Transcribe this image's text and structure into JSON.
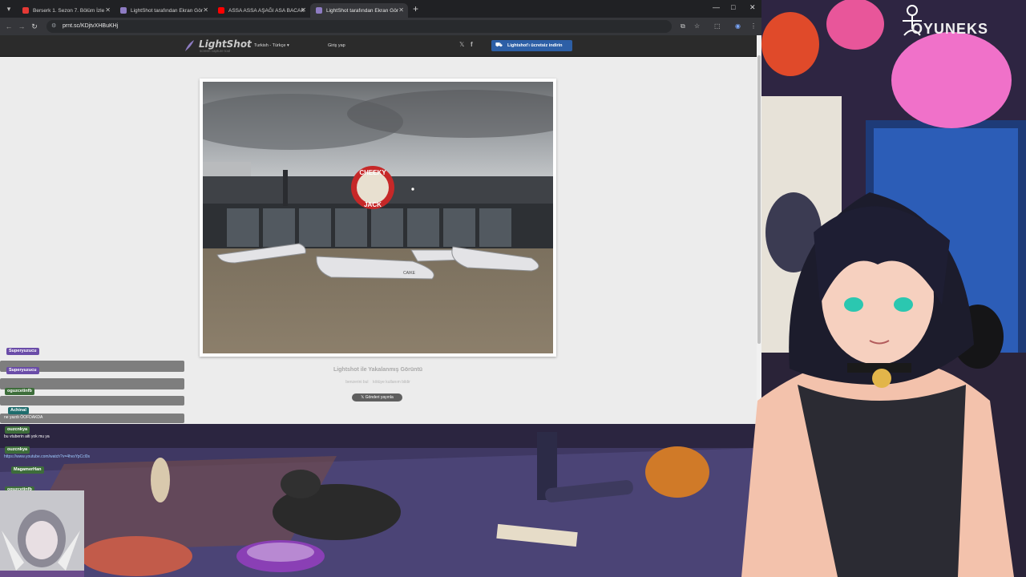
{
  "browser": {
    "tabs": [
      {
        "title": "Berserk 1. Sezon 7. Bölüm İzle",
        "favicon_color": "#e53935",
        "active": false
      },
      {
        "title": "LightShot tarafından Ekran Gör",
        "favicon_color": "#8e7cc3",
        "active": false
      },
      {
        "title": "ASSA ASSA AŞAĞI ASA BACAK",
        "favicon_color": "#ff0000",
        "active": false
      },
      {
        "title": "LightShot tarafından Ekran Gör",
        "favicon_color": "#8e7cc3",
        "active": true
      }
    ],
    "new_tab_label": "+",
    "url": "prnt.sc/KDjtvXHBuKHj",
    "window_controls": {
      "minimize": "—",
      "maximize": "□",
      "close": "✕"
    },
    "icons": {
      "back": "arrow-left-icon",
      "forward": "arrow-right-icon",
      "reload": "reload-icon",
      "bookmark": "star-icon",
      "extensions": "puzzle-icon",
      "menu": "kebab-icon"
    }
  },
  "lightshot": {
    "logo": "LightShot",
    "tagline": "screen capture tool",
    "language": "Turkish - Türkçe ▾",
    "login": "Giriş yap",
    "twitter_glyph": "𝕏",
    "facebook_glyph": "f",
    "download_label": "Lightshot'ı ücretsiz indirin",
    "caption": "Lightshot ile Yakalanmış Görüntü",
    "meta_left": "benzerini bul",
    "meta_right": "kötüye kullanım bildir",
    "share_label": "𝕏 Gönderi yayınla",
    "image": {
      "sign_top": "CHEEKY",
      "sign_bottom": "JACK",
      "boat_label": "CAIKE"
    }
  },
  "overlay": {
    "channel_name": "OYUNEKS",
    "chat": [
      {
        "user": "Superyuzucu",
        "text": "",
        "user_color": "#6a4ca8"
      },
      {
        "user": "Superyuzucu",
        "text": "",
        "user_color": "#6a4ca8"
      },
      {
        "user": "oguzcetinfb",
        "text": "",
        "user_color": "#3d6d3a"
      },
      {
        "user": "Achinal",
        "text": "ne yazdı ÖOFDAKDA",
        "user_color": "#1f6d6d"
      },
      {
        "user": "ouzcnkya",
        "text": "bu vtuberin aiti yok mu ya",
        "user_color": "#3d6d3a"
      },
      {
        "user": "ouzcnkya",
        "text": "https://www.youtube.com/watch?v=4hvsYpCcl0s",
        "user_color": "#3d6d3a"
      },
      {
        "user": "MagamerHan",
        "text": "",
        "user_color": "#3d6d3a"
      },
      {
        "user": "oguzcetinfb",
        "text": "",
        "user_color": "#3d6d3a"
      }
    ]
  }
}
